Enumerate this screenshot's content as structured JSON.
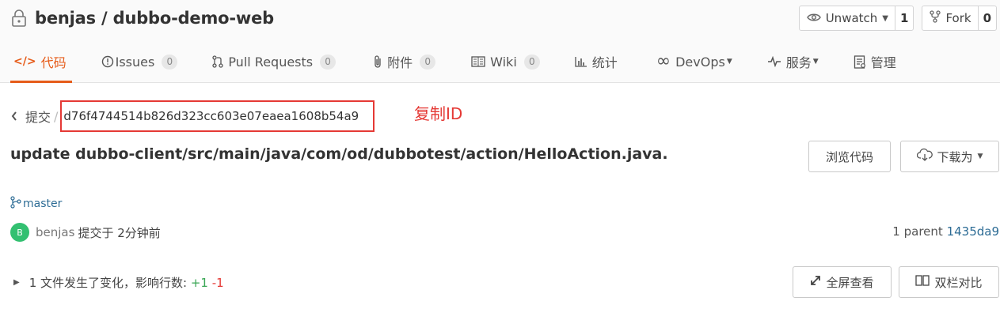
{
  "repo": {
    "owner": "benjas",
    "separator": " / ",
    "name": "dubbo-demo-web"
  },
  "actions": {
    "watch_label": "Unwatch",
    "watch_count": "1",
    "fork_label": "Fork",
    "fork_count": "0"
  },
  "tabs": [
    {
      "label": "代码"
    },
    {
      "label": "Issues",
      "badge": "0"
    },
    {
      "label": "Pull Requests",
      "badge": "0"
    },
    {
      "label": "附件",
      "badge": "0"
    },
    {
      "label": "Wiki",
      "badge": "0"
    },
    {
      "label": "统计"
    },
    {
      "label": "DevOps"
    },
    {
      "label": "服务"
    },
    {
      "label": "管理"
    }
  ],
  "breadcrumb": {
    "back_label": "提交",
    "separator": "/",
    "commit_id": "d76f4744514b826d323cc603e07eaea1608b54a9"
  },
  "annotation": "复制ID",
  "commit": {
    "message": "update dubbo-client/src/main/java/com/od/dubbotest/action/HelloAction.java.",
    "browse_label": "浏览代码",
    "download_label": "下载为",
    "branch": "master",
    "avatar_letter": "B",
    "author": "benjas",
    "time_text": "提交于 2分钟前",
    "parent_label": "1 parent",
    "parent_hash": "1435da9"
  },
  "changes": {
    "summary": "1 文件发生了变化，影响行数:",
    "additions": "+1",
    "deletions": "-1",
    "fullscreen_label": "全屏查看",
    "split_label": "双栏对比"
  },
  "colors": {
    "accent": "#e65c1a",
    "highlight_red": "#e53935",
    "link_blue": "#2d6c95",
    "avatar_green": "#33c071"
  }
}
